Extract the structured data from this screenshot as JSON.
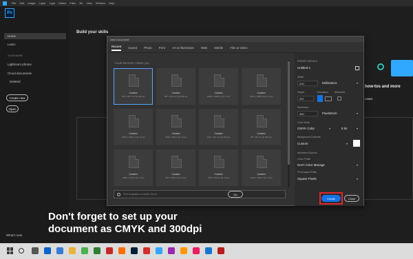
{
  "menubar": {
    "items": [
      "File",
      "Edit",
      "Image",
      "Layer",
      "Type",
      "Select",
      "Filter",
      "3D",
      "View",
      "Window",
      "Help"
    ]
  },
  "app": {
    "logo": "Ps"
  },
  "sidebar": {
    "home": "Home",
    "learn": "Learn",
    "section": "YOUR WORK",
    "items": [
      "Lightroom photos",
      "Cloud documents",
      "Deleted"
    ],
    "create_new": "Create new",
    "open": "Open",
    "whats_new": "What's new"
  },
  "home": {
    "title": "Build your skills",
    "promo": "how-tos and more",
    "promo_link": "Learn"
  },
  "dialog": {
    "title": "New Document",
    "tabs": [
      "Recent",
      "Saved",
      "Photo",
      "Print",
      "Art & Illustration",
      "Web",
      "Mobile",
      "Film & Video"
    ],
    "recent_label": "YOUR RECENT ITEMS (12)",
    "cards": [
      {
        "title": "Custom",
        "sub": "210 x 297 mm @ 300 ppi"
      },
      {
        "title": "Custom",
        "sub": "297 x 210 mm @ 300 ppi"
      },
      {
        "title": "Custom",
        "sub": "1080 x 1080 px @ 72 ppi"
      },
      {
        "title": "Custom",
        "sub": "1920 x 1080 px @ 72 ppi"
      },
      {
        "title": "Custom",
        "sub": "1000 x 1000 px @ 72 ppi"
      },
      {
        "title": "Custom",
        "sub": "1200 x 628 px @ 72 ppi"
      },
      {
        "title": "Custom",
        "sub": "148 x 210 mm @ 300 ppi"
      },
      {
        "title": "Custom",
        "sub": "85 x 55 mm @ 300 ppi"
      },
      {
        "title": "Custom",
        "sub": "1280 x 720 px @ 72 ppi"
      },
      {
        "title": "Custom",
        "sub": "800 x 600 px @ 72 ppi"
      },
      {
        "title": "Custom",
        "sub": "1500 x 500 px @ 72 ppi"
      },
      {
        "title": "Custom",
        "sub": "1024 x 768 px @ 72 ppi"
      }
    ],
    "search_placeholder": "Find templates on Adobe Stock",
    "go": "Go"
  },
  "preset": {
    "header": "PRESET DETAILS",
    "name": "Untitled-1",
    "width_label": "Width",
    "width": "210",
    "width_unit": "Millimeters",
    "height_label": "Height",
    "height": "297",
    "orientation_label": "Orientation",
    "artboards_label": "Artboards",
    "resolution_label": "Resolution",
    "resolution": "300",
    "resolution_unit": "Pixels/Inch",
    "color_mode_label": "Color Mode",
    "color_mode": "CMYK Color",
    "bit_depth": "8 bit",
    "background_label": "Background Contents",
    "background": "Custom",
    "advanced_label": "Advanced Options",
    "color_profile_label": "Color Profile",
    "color_profile": "Don't Color Manage",
    "pixel_aspect_label": "Pixel Aspect Ratio",
    "pixel_aspect": "Square Pixels",
    "create": "Create",
    "close": "Close"
  },
  "caption": {
    "line1": "Don't forget to set up your",
    "line2": "document as CMYK and 300dpi"
  },
  "colors": {
    "accent": "#1473e6",
    "highlight": "#e3262e",
    "brand": "#31a8ff"
  }
}
